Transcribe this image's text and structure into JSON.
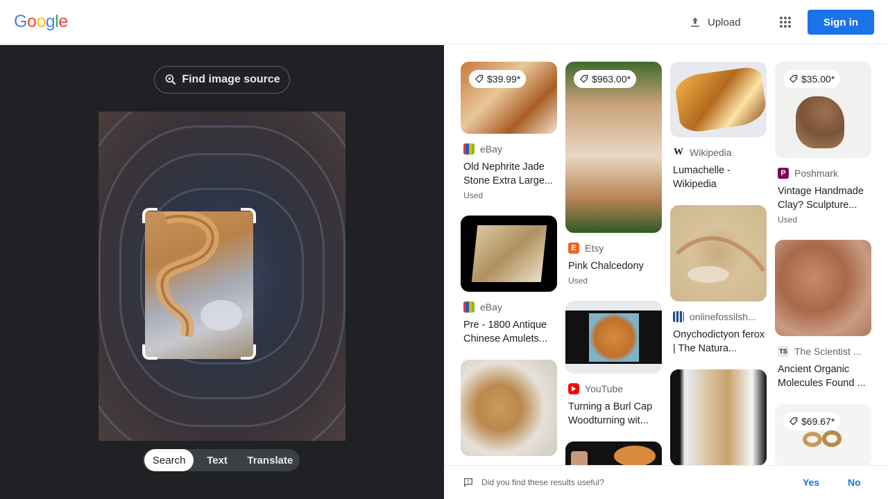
{
  "header": {
    "logo": [
      "G",
      "o",
      "o",
      "g",
      "l",
      "e"
    ],
    "logo_colors": [
      "#4285F4",
      "#EA4335",
      "#FBBC05",
      "#4285F4",
      "#34A853",
      "#EA4335"
    ],
    "upload_label": "Upload",
    "signin_label": "Sign in"
  },
  "left": {
    "find_source_label": "Find image source",
    "tabs": [
      "Search",
      "Text",
      "Translate"
    ],
    "active_tab": "Search"
  },
  "results": [
    {
      "price": "$39.99*",
      "source": "eBay",
      "source_icon": "ebay-bag-icon",
      "title": "Old Nephrite Jade Stone Extra Large...",
      "note": "Used"
    },
    {
      "price": "$963.00*",
      "source": "Etsy",
      "source_icon": "etsy-icon",
      "title": "Pink Chalcedony",
      "note": "Used"
    },
    {
      "price": "",
      "source": "Wikipedia",
      "source_icon": "wikipedia-icon",
      "title": "Lumachelle - Wikipedia",
      "note": ""
    },
    {
      "price": "$35.00*",
      "source": "Poshmark",
      "source_icon": "poshmark-icon",
      "title": "Vintage Handmade Clay? Sculpture...",
      "note": "Used"
    },
    {
      "price": "",
      "source": "eBay",
      "source_icon": "ebay-bag-icon",
      "title": "Pre - 1800 Antique Chinese Amulets...",
      "note": ""
    },
    {
      "price": "",
      "source": "YouTube",
      "source_icon": "youtube-icon",
      "title": "Turning a Burl Cap Woodturning wit...",
      "note": ""
    },
    {
      "price": "",
      "source": "onlinefossilsh...",
      "source_icon": "grid-favicon-icon",
      "title": "Onychodictyon ferox | The Natura...",
      "note": ""
    },
    {
      "price": "",
      "source": "The Scientist ...",
      "source_icon": "ts-icon",
      "title": "Ancient Organic Molecules Found ...",
      "note": ""
    },
    {
      "price": "",
      "source": "",
      "source_icon": "",
      "title": "",
      "note": ""
    },
    {
      "price": "",
      "source": "",
      "source_icon": "",
      "title": "",
      "note": ""
    },
    {
      "price": "",
      "source": "",
      "source_icon": "",
      "title": "",
      "note": ""
    },
    {
      "price": "$69.67*",
      "source": "",
      "source_icon": "",
      "title": "",
      "note": ""
    }
  ],
  "feedback": {
    "question": "Did you find these results useful?",
    "yes": "Yes",
    "no": "No"
  }
}
